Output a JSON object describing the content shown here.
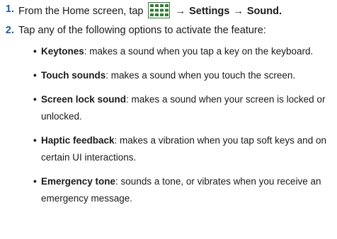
{
  "steps": [
    {
      "number": "1.",
      "text_before": "From the Home screen, tap",
      "icon": "apps-grid-icon",
      "arrow": "→",
      "settings": "Settings",
      "sound": "Sound",
      "end": "."
    },
    {
      "number": "2.",
      "text": "Tap any of the following options to activate the feature:"
    }
  ],
  "options": [
    {
      "term": "Keytones",
      "description": ": makes a sound when you tap a key on the keyboard."
    },
    {
      "term": "Touch sounds",
      "description": ": makes a sound when you touch the screen."
    },
    {
      "term": "Screen lock sound",
      "description": ": makes a sound when your screen is locked or unlocked."
    },
    {
      "term": "Haptic feedback",
      "description": ": makes a vibration when you tap soft keys and on certain UI interactions."
    },
    {
      "term": "Emergency tone",
      "description": ": sounds a tone, or vibrates when you receive an emergency message."
    }
  ],
  "colors": {
    "step_number": "#1e5aa8",
    "icon_fill": "#2e7d32"
  }
}
